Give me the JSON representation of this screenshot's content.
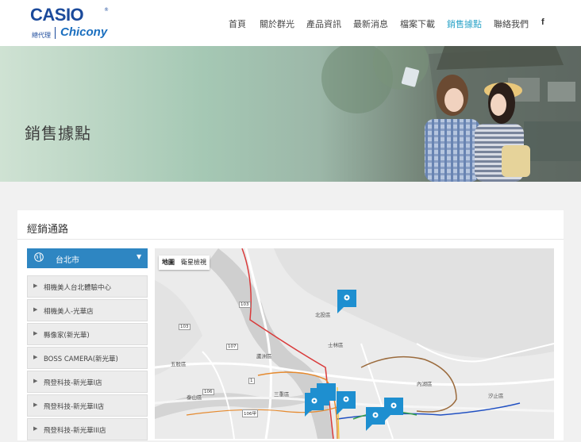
{
  "header": {
    "logo_text": "CASIO",
    "logo_reg": "®",
    "agent_text": "總代理",
    "partner_text": "Chicony",
    "nav": [
      {
        "label": "首頁",
        "active": false
      },
      {
        "label": "關於群光",
        "active": false
      },
      {
        "label": "產品資訊",
        "active": false
      },
      {
        "label": "最新消息",
        "active": false
      },
      {
        "label": "檔案下載",
        "active": false
      },
      {
        "label": "銷售據點",
        "active": true
      },
      {
        "label": "聯絡我們",
        "active": false
      }
    ],
    "facebook_label": "f",
    "colors": {
      "brand": "#1b4a9b",
      "active": "#2aa3c7"
    }
  },
  "hero": {
    "title": "銷售據點"
  },
  "section": {
    "title": "經銷通路",
    "city": {
      "selected": "台北市"
    },
    "stores": [
      "相機美人台北體驗中心",
      "相機美人-光華店",
      "縣像家(新光華)",
      "BOSS CAMERA(新光華)",
      "飛登科技-新光華I店",
      "飛登科技-新光華II店",
      "飛登科技-新光華III店"
    ]
  },
  "map": {
    "tabs": [
      "地圖",
      "衛星檢視"
    ],
    "labels": [
      "北投區",
      "士林區",
      "內湖區",
      "五股區",
      "三重區",
      "泰山區",
      "蘆洲區",
      "汐止區"
    ],
    "road_numbers": [
      "103",
      "107",
      "106",
      "1",
      "103",
      "106甲"
    ],
    "marker_color": "#1e8fd0"
  }
}
